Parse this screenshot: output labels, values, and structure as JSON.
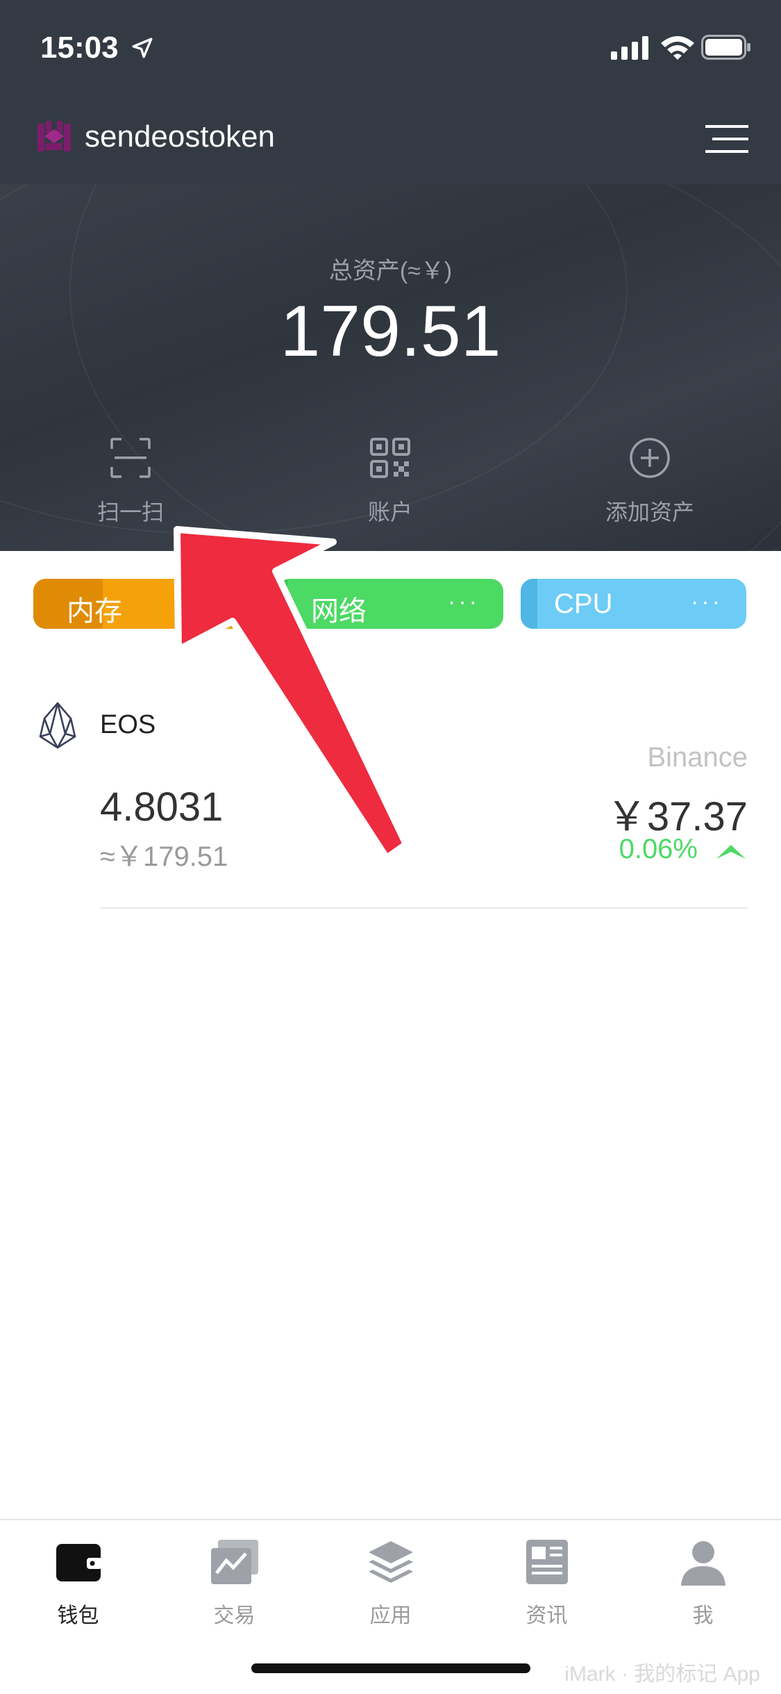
{
  "status_bar": {
    "time": "15:03"
  },
  "header": {
    "account_name": "sendeostoken"
  },
  "summary": {
    "label": "总资产(≈￥)",
    "value": "179.51"
  },
  "actions": [
    {
      "label": "扫一扫",
      "icon": "scan-icon"
    },
    {
      "label": "账户",
      "icon": "qr-code-icon"
    },
    {
      "label": "添加资产",
      "icon": "add-circle-icon"
    }
  ],
  "resources": [
    {
      "label": "内存",
      "color": "#f5a10a"
    },
    {
      "label": "网络",
      "color": "#4cd964",
      "dots": "···"
    },
    {
      "label": "CPU",
      "color": "#6cccf5",
      "dots": "···"
    }
  ],
  "token": {
    "name": "EOS",
    "exchange": "Binance",
    "amount": "4.8031",
    "approx_value": "≈￥179.51",
    "price": "￥37.37",
    "change": "0.06%"
  },
  "tabbar": {
    "items": [
      {
        "label": "钱包",
        "icon": "wallet-icon",
        "active": true
      },
      {
        "label": "交易",
        "icon": "trade-chart-icon",
        "active": false
      },
      {
        "label": "应用",
        "icon": "layers-icon",
        "active": false
      },
      {
        "label": "资讯",
        "icon": "news-icon",
        "active": false
      },
      {
        "label": "我",
        "icon": "user-icon",
        "active": false
      }
    ]
  },
  "watermark": "iMark · 我的标记 App",
  "colors": {
    "header_bg": "#333a43",
    "accent_green": "#4cd964",
    "arrow_red": "#ee2b3f"
  }
}
